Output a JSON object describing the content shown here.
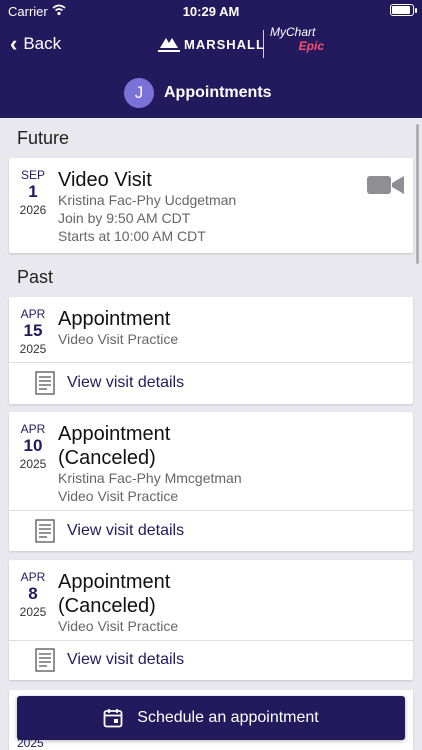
{
  "status": {
    "carrier": "Carrier",
    "time": "10:29 AM"
  },
  "nav": {
    "back_label": "Back"
  },
  "logos": {
    "marshall": "MARSHALL",
    "mychart": "MyChart",
    "epic": "Epic"
  },
  "header": {
    "avatar_initial": "J",
    "title": "Appointments"
  },
  "sections": {
    "future": "Future",
    "past": "Past"
  },
  "future": [
    {
      "month": "SEP",
      "day": "1",
      "year": "2026",
      "title": "Video Visit",
      "provider": "Kristina Fac-Phy Ucdgetman",
      "join": "Join by 9:50 AM CDT",
      "starts": "Starts at 10:00 AM CDT",
      "icon": "video-camera-icon"
    }
  ],
  "past": [
    {
      "month": "APR",
      "day": "15",
      "year": "2025",
      "title": "Appointment",
      "lines": [
        "Video Visit Practice"
      ],
      "details_label": "View visit details"
    },
    {
      "month": "APR",
      "day": "10",
      "year": "2025",
      "title_line1": "Appointment",
      "title_line2": "(Canceled)",
      "lines": [
        "Kristina Fac-Phy Mmcgetman",
        "Video Visit Practice"
      ],
      "details_label": "View visit details"
    },
    {
      "month": "APR",
      "day": "8",
      "year": "2025",
      "title_line1": "Appointment",
      "title_line2": "(Canceled)",
      "lines": [
        "Video Visit Practice"
      ],
      "details_label": "View visit details"
    }
  ],
  "peek": {
    "year": "2025"
  },
  "schedule_button": {
    "label": "Schedule an appointment",
    "icon": "calendar-icon"
  },
  "colors": {
    "brand": "#231a5e",
    "avatar": "#7b72d9",
    "background": "#e8e8ee",
    "epic": "#ff4d6d"
  }
}
